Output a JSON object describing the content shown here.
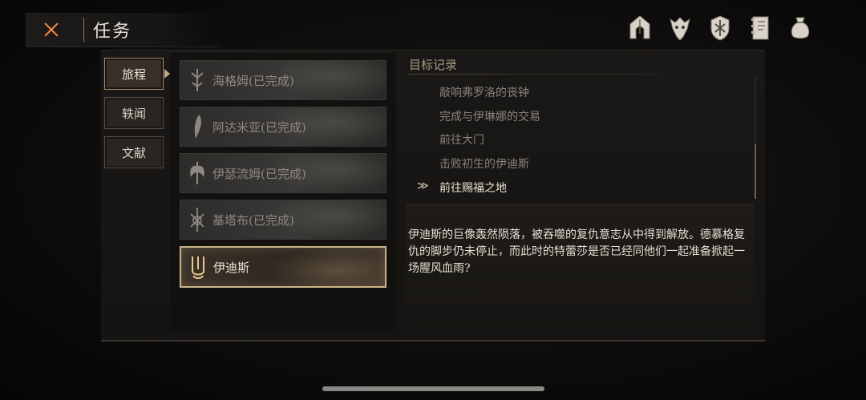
{
  "header": {
    "title": "任务"
  },
  "side_tabs": [
    {
      "label": "旅程",
      "active": true
    },
    {
      "label": "轶闻",
      "active": false
    },
    {
      "label": "文献",
      "active": false
    }
  ],
  "quests": [
    {
      "label": "海格姆(已完成)",
      "icon": "rune-icon",
      "active": false
    },
    {
      "label": "阿达米亚(已完成)",
      "icon": "feather-blade-icon",
      "active": false
    },
    {
      "label": "伊瑟流姆(已完成)",
      "icon": "winged-axe-icon",
      "active": false
    },
    {
      "label": "基塔布(已完成)",
      "icon": "crossed-sigil-icon",
      "active": false
    },
    {
      "label": "伊迪斯",
      "icon": "flame-crest-icon",
      "active": true
    }
  ],
  "objectives": {
    "title": "目标记录",
    "items": [
      {
        "label": "敲响弗罗洛的丧钟",
        "current": false
      },
      {
        "label": "完成与伊琳娜的交易",
        "current": false
      },
      {
        "label": "前往大门",
        "current": false
      },
      {
        "label": "击败初生的伊迪斯",
        "current": false
      },
      {
        "label": "前往赐福之地",
        "current": true
      }
    ],
    "current_marker": "≫"
  },
  "description": "伊迪斯的巨像轰然陨落，被吞噬的复仇意志从中得到解放。德慕格复仇的脚步仍未停止，而此时的特蕾莎是否已经同他们一起准备掀起一场腥风血雨?",
  "top_icons": [
    "helmet-icon",
    "beast-mask-icon",
    "shield-crest-icon",
    "journal-icon",
    "pouch-icon"
  ],
  "colors": {
    "accent": "#c9b48a",
    "close": "#d9702e",
    "text": "#e7dfd2"
  }
}
